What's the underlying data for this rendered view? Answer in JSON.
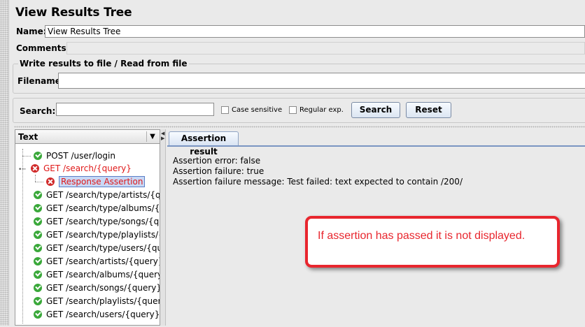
{
  "title": "View Results Tree",
  "name_field": {
    "label": "Name:",
    "value": "View Results Tree"
  },
  "comments_field": {
    "label": "Comments:"
  },
  "file_group": {
    "title": "Write results to file / Read from file",
    "filename_label": "Filename"
  },
  "search": {
    "label": "Search:",
    "value": "",
    "case_sensitive_label": "Case sensitive",
    "regular_exp_label": "Regular exp.",
    "search_button": "Search",
    "reset_button": "Reset"
  },
  "renderer_combo": {
    "selected": "Text"
  },
  "tree": {
    "items": [
      {
        "label": "POST /user/login",
        "status": "ok"
      },
      {
        "label": "GET /search/{query}",
        "status": "error"
      },
      {
        "label": "Response Assertion",
        "status": "error"
      },
      {
        "label": "GET /search/type/artists/{que",
        "status": "ok"
      },
      {
        "label": "GET /search/type/albums/{qu",
        "status": "ok"
      },
      {
        "label": "GET /search/type/songs/{que",
        "status": "ok"
      },
      {
        "label": "GET /search/type/playlists/{q",
        "status": "ok"
      },
      {
        "label": "GET /search/type/users/{que",
        "status": "ok"
      },
      {
        "label": "GET /search/artists/{query}",
        "status": "ok"
      },
      {
        "label": "GET /search/albums/{query}",
        "status": "ok"
      },
      {
        "label": "GET /search/songs/{query}",
        "status": "ok"
      },
      {
        "label": "GET /search/playlists/{query",
        "status": "ok"
      },
      {
        "label": "GET /search/users/{query}",
        "status": "ok"
      }
    ]
  },
  "result_tab": {
    "label": "Assertion result"
  },
  "assertion_result": {
    "line1": "Assertion error: false",
    "line2": "Assertion failure: true",
    "line3": "Assertion failure message: Test failed: text expected to contain /200/"
  },
  "callout": {
    "text": "If assertion has passed it is not displayed."
  },
  "colors": {
    "error_red": "#e01818",
    "ok_green": "#3aa83a",
    "callout_red": "#e8262e"
  }
}
